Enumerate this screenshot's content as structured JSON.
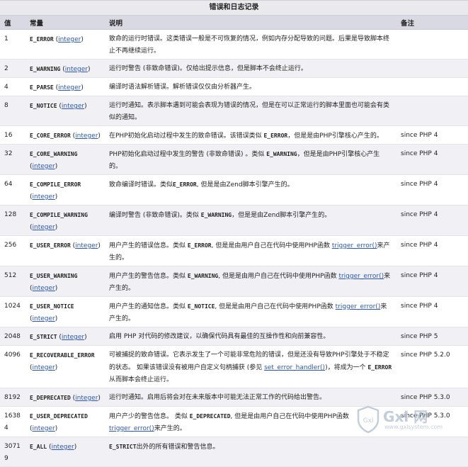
{
  "table": {
    "caption": "错误和日志记录",
    "headers": {
      "value": "值",
      "constant": "常量",
      "description": "说明",
      "note": "备注"
    },
    "type_link": "integer",
    "rows": [
      {
        "value": "1",
        "constant": "E_ERROR",
        "desc": [
          {
            "t": "致命的运行时错误。这类错误一般是不可恢复的情况，例如内存分配导致的问题。后果是导致脚本终止不再继续运行。"
          }
        ],
        "note": ""
      },
      {
        "value": "2",
        "constant": "E_WARNING",
        "desc": [
          {
            "t": "运行时警告 (非致命错误)。仅给出提示信息，但是脚本不会终止运行。"
          }
        ],
        "note": ""
      },
      {
        "value": "4",
        "constant": "E_PARSE",
        "desc": [
          {
            "t": "编译时语法解析错误。解析错误仅仅由分析器产生。"
          }
        ],
        "note": ""
      },
      {
        "value": "8",
        "constant": "E_NOTICE",
        "desc": [
          {
            "t": "运行时通知。表示脚本遇到可能会表现为错误的情况，但是在可以正常运行的脚本里面也可能会有类似的通知。"
          }
        ],
        "note": ""
      },
      {
        "value": "16",
        "constant": "E_CORE_ERROR",
        "desc": [
          {
            "t": "在PHP初始化启动过程中发生的致命错误。该错误类似 "
          },
          {
            "m": "E_ERROR"
          },
          {
            "t": "，但是是由PHP引擎核心产生的。"
          }
        ],
        "note": "since PHP 4"
      },
      {
        "value": "32",
        "constant": "E_CORE_WARNING",
        "desc": [
          {
            "t": "PHP初始化启动过程中发生的警告 (非致命错误) 。类似 "
          },
          {
            "m": "E_WARNING"
          },
          {
            "t": "，但是是由PHP引擎核心产生的。"
          }
        ],
        "note": "since PHP 4"
      },
      {
        "value": "64",
        "constant": "E_COMPILE_ERROR",
        "desc": [
          {
            "t": "致命编译时错误。类似"
          },
          {
            "m": "E_ERROR"
          },
          {
            "t": ", 但是是由Zend脚本引擎产生的。"
          }
        ],
        "note": "since PHP 4"
      },
      {
        "value": "128",
        "constant": "E_COMPILE_WARNING",
        "desc": [
          {
            "t": "编译时警告 (非致命错误)。类似 "
          },
          {
            "m": "E_WARNING"
          },
          {
            "t": "，但是是由Zend脚本引擎产生的。"
          }
        ],
        "note": "since PHP 4"
      },
      {
        "value": "256",
        "constant": "E_USER_ERROR",
        "desc": [
          {
            "t": "用户产生的错误信息。类似 "
          },
          {
            "m": "E_ERROR"
          },
          {
            "t": ", 但是是由用户自己在代码中使用PHP函数 "
          },
          {
            "l": "trigger_error()"
          },
          {
            "t": "来产生的。"
          }
        ],
        "note": "since PHP 4"
      },
      {
        "value": "512",
        "constant": "E_USER_WARNING",
        "desc": [
          {
            "t": "用户产生的警告信息。类似 "
          },
          {
            "m": "E_WARNING"
          },
          {
            "t": ", 但是是由用户自己在代码中使用PHP函数 "
          },
          {
            "l": "trigger_error()"
          },
          {
            "t": "来产生的。"
          }
        ],
        "note": "since PHP 4"
      },
      {
        "value": "1024",
        "constant": "E_USER_NOTICE",
        "desc": [
          {
            "t": "用户产生的通知信息。类似 "
          },
          {
            "m": "E_NOTICE"
          },
          {
            "t": ", 但是是由用户自己在代码中使用PHP函数 "
          },
          {
            "l": "trigger_error()"
          },
          {
            "t": "来产生的。"
          }
        ],
        "note": "since PHP 4"
      },
      {
        "value": "2048",
        "constant": "E_STRICT",
        "desc": [
          {
            "t": "启用 PHP 对代码的修改建议，以确保代码具有最佳的互操作性和向前兼容性。"
          }
        ],
        "note": "since PHP 5"
      },
      {
        "value": "4096",
        "constant": "E_RECOVERABLE_ERROR",
        "desc": [
          {
            "t": "可被捕捉的致命错误。它表示发生了一个可能非常危险的错误，但是还没有导致PHP引擎处于不稳定的状态。 如果该错误没有被用户自定义句柄捕获 (参见 "
          },
          {
            "l": "set_error_handler()"
          },
          {
            "t": ")，将成为一个 "
          },
          {
            "m": "E_ERROR"
          },
          {
            "t": "　从而脚本会终止运行。"
          }
        ],
        "note": "since PHP 5.2.0"
      },
      {
        "value": "8192",
        "constant": "E_DEPRECATED",
        "desc": [
          {
            "t": "运行时通知。启用后将会对在未来版本中可能无法正常工作的代码给出警告。"
          }
        ],
        "note": "since PHP 5.3.0"
      },
      {
        "value": "16384",
        "constant": "E_USER_DEPRECATED",
        "desc": [
          {
            "t": "用户产少的警告信息。 类似 "
          },
          {
            "m": "E_DEPRECATED"
          },
          {
            "t": ", 但是是由用户自己在代码中使用PHP函数 "
          },
          {
            "l": "trigger_error()"
          },
          {
            "t": "来产生的。"
          }
        ],
        "note": "since PHP 5.3.0"
      },
      {
        "value": "30719",
        "constant": "E_ALL",
        "desc": [
          {
            "m": "E_STRICT"
          },
          {
            "t": "出外的所有错误和警告信息。"
          }
        ],
        "note": ""
      }
    ]
  },
  "watermark": {
    "shield_text": "Gxl",
    "name": "Gxl 网",
    "url": "www.gxlsystem.com"
  },
  "colors": {
    "link": "#2a57b8",
    "header_bg": "#d9d9e3",
    "row_alt_bg": "#f1f1f5"
  }
}
